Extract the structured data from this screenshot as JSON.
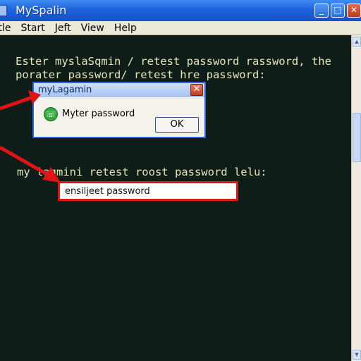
{
  "window": {
    "title": "MySpalin",
    "controls": {
      "minimize": "_",
      "maximize": "□",
      "close": "✕"
    }
  },
  "menu": {
    "items": [
      "ttle",
      "Start",
      "Jeft",
      "View",
      "Help"
    ]
  },
  "terminal": {
    "lines": [
      "Ester myslaSqmin / retest password rassword, the",
      "porater password/ retest hre password:",
      "my lagmini retest roost password lelu:"
    ]
  },
  "dialog": {
    "title": "myLagamin",
    "message": "Myter password",
    "ok_label": "OK",
    "close_glyph": "✕",
    "icon": "green-phone-icon",
    "icon_glyph": "☏"
  },
  "password_field": {
    "value": "ensiljeet password"
  },
  "annotations": {
    "arrow_color": "#e01414"
  }
}
